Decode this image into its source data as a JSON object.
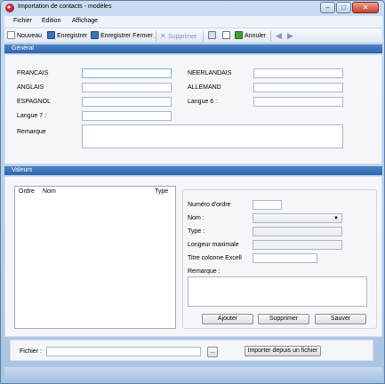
{
  "window": {
    "title": "Importation de contacts - modèles",
    "min_label": "–",
    "max_label": "□",
    "close_label": "✕"
  },
  "menu": [
    "Fichier",
    "Edition",
    "Affichage"
  ],
  "toolbar": {
    "nouveau": "Nouveau",
    "enregistrer": "Enregistrer",
    "enregistrer_fermer": "Enregistrer Fermer",
    "supprimer": "Supprimer",
    "annuler": "Annuler"
  },
  "general": {
    "header": "Général",
    "francais": "FRANCAIS",
    "anglais": "ANGLAIS",
    "espagnol": "ESPAGNOL",
    "langue7": "Langue 7 :",
    "remarque": "Remarque",
    "neerlandais": "NEERLANDAIS",
    "allemand": "ALLEMAND",
    "langue6": "Langue 6 :"
  },
  "valeurs": {
    "header": "Valeurs",
    "columns": [
      "Ordre",
      "Nom",
      "Type"
    ],
    "numero_ordre": "Numéro d'ordre",
    "nom": "Nom :",
    "type": "Type :",
    "longueur_max": "Longeur maximale",
    "titre_colonne": "Titre colonne Excell",
    "remarque": "Remarque :",
    "ajouter": "Ajouter",
    "supprimer": "Supprimer",
    "sauver": "Sauver"
  },
  "fichier": {
    "label": "Fichier :",
    "browse": "...",
    "import": "Importer depuis un fichier"
  },
  "icons": {
    "nouveau": "new-document-icon",
    "enregistrer": "save-icon",
    "enregistrer_fermer": "save-close-icon",
    "supprimer": "delete-icon",
    "print": "print-icon",
    "preview": "print-preview-icon",
    "annuler": "undo-icon",
    "back": "arrow-left-icon",
    "forward": "arrow-right-icon"
  }
}
